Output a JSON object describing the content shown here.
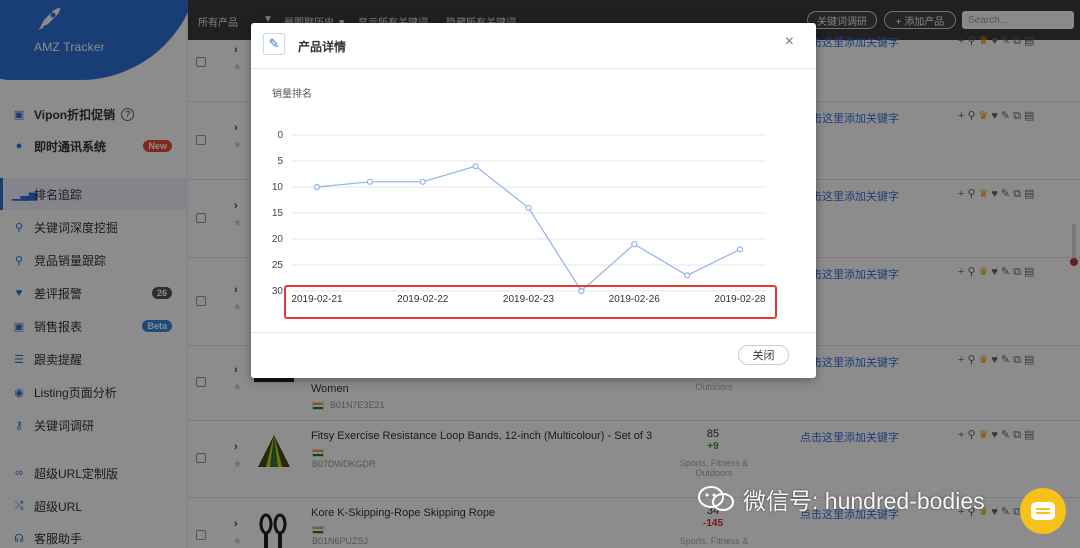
{
  "app": {
    "logo_text": "AMZ Tracker"
  },
  "sidebar": {
    "items": [
      {
        "label": "Vipon折扣促销",
        "icon": "gift-icon",
        "help": "?"
      },
      {
        "label": "即时通讯系统",
        "icon": "chat-icon",
        "badge": "New"
      },
      {
        "label": "排名追踪",
        "icon": "bar-chart-icon",
        "active": true
      },
      {
        "label": "关键词深度挖掘",
        "icon": "search-icon"
      },
      {
        "label": "竞品销量跟踪",
        "icon": "search-icon"
      },
      {
        "label": "差评报警",
        "icon": "heart-icon",
        "badge": "26"
      },
      {
        "label": "销售报表",
        "icon": "gift-icon",
        "badge": "Beta"
      },
      {
        "label": "跟卖提醒",
        "icon": "list-icon"
      },
      {
        "label": "Listing页面分析",
        "icon": "eye-icon"
      },
      {
        "label": "关键词调研",
        "icon": "key-icon"
      },
      {
        "label": "超级URL定制版",
        "icon": "link-icon"
      },
      {
        "label": "超级URL",
        "icon": "shuffle-icon"
      },
      {
        "label": "客服助手",
        "icon": "headset-icon"
      }
    ]
  },
  "topbar": {
    "filters": [
      "所有产品",
      "▼",
      "最图聊历史 ▼",
      "显示所有关键词",
      "隐藏所有关键词"
    ],
    "keyword_research_button": "关键词调研",
    "add_product_button": "+ 添加产品",
    "search_placeholder": "Search..."
  },
  "rows": {
    "add_keyword_label": "点击这里添加关键字",
    "row5": {
      "title_partial": "Women",
      "asin": "B01N7E3E21",
      "category": "Outdoors"
    },
    "row6": {
      "title": "Fitsy Exercise Resistance Loop Bands, 12-inch (Multicolour) - Set of 3",
      "asin": "B07DWDKGDR",
      "rank": "85",
      "change": "+9",
      "category": "Sports, Fitness & Outdoors"
    },
    "row7": {
      "title": "Kore K-Skipping-Rope Skipping Rope",
      "asin": "B01N6PUZSJ",
      "rank": "34",
      "change": "-145",
      "category": "Sports, Fitness &"
    }
  },
  "modal": {
    "title": "产品详情",
    "close_icon": "×",
    "close_button": "关闭",
    "highlight_color": "#e53935"
  },
  "chart_data": {
    "type": "line",
    "ylabel": "销量排名",
    "y_ticks": [
      0,
      5,
      10,
      15,
      20,
      25,
      30
    ],
    "ylim": [
      0,
      30
    ],
    "y_inverted": true,
    "x_tick_labels": [
      "2019-02-21",
      "2019-02-22",
      "2019-02-23",
      "2019-02-26",
      "2019-02-28"
    ],
    "points": [
      {
        "x": 0,
        "y": 10
      },
      {
        "x": 0.5,
        "y": 9
      },
      {
        "x": 1,
        "y": 9
      },
      {
        "x": 1.5,
        "y": 6
      },
      {
        "x": 2,
        "y": 14
      },
      {
        "x": 2.5,
        "y": 30
      },
      {
        "x": 3,
        "y": 21
      },
      {
        "x": 3.5,
        "y": 27
      },
      {
        "x": 4,
        "y": 22
      }
    ],
    "line_color": "#8fb3ec",
    "grid": true
  },
  "watermark": {
    "text": "微信号: hundred-bodies"
  }
}
